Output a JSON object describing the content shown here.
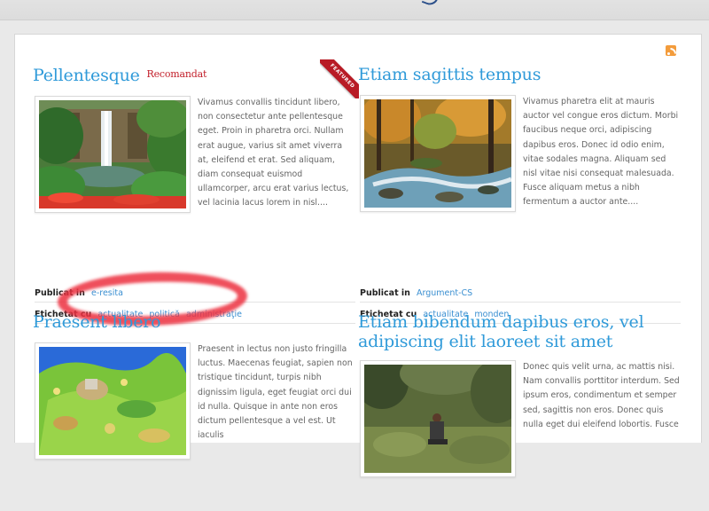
{
  "articles": [
    {
      "title": "Pellentesque",
      "badge": "Recomandat",
      "excerpt": "Vivamus convallis tincidunt libero, non consectetur ante pellentesque eget. Proin in pharetra orci. Nullam erat augue, varius sit amet viverra at, eleifend et erat. Sed aliquam, diam consequat euismod ullamcorper, arcu erat varius lectus, vel lacinia lacus lorem in nisl....",
      "published_label": "Publicat in",
      "category": "e-resita",
      "tags_label": "Etichetat cu",
      "tags": [
        "actualitate",
        "politică",
        "administraţie"
      ]
    },
    {
      "title": "Etiam sagittis tempus",
      "ribbon": "FEATURED",
      "excerpt": "Vivamus pharetra elit at mauris auctor vel congue eros dictum. Morbi faucibus neque orci, adipiscing dapibus eros. Donec id odio enim, vitae sodales magna. Aliquam sed nisl vitae nisi consequat malesuada. Fusce aliquam metus a nibh fermentum a auctor ante....",
      "published_label": "Publicat in",
      "category": "Argument-CS",
      "tags_label": "Etichetat cu",
      "tags": [
        "actualitate",
        "monden"
      ]
    },
    {
      "title": "Praesent libero",
      "excerpt": "Praesent in lectus non justo fringilla luctus. Maecenas feugiat, sapien non tristique tincidunt, turpis nibh dignissim ligula, eget feugiat orci dui id nulla. Quisque in ante non eros dictum pellentesque a vel est. Ut iaculis"
    },
    {
      "title": "Etiam bibendum dapibus eros, vel adipiscing elit laoreet sit amet",
      "excerpt": "Donec quis velit urna, ac mattis nisi. Nam convallis porttitor interdum. Sed ipsum eros, condimentum et semper sed, sagittis non eros. Donec quis nulla eget dui eleifend lobortis. Fusce"
    }
  ],
  "colors": {
    "title": "#2f9ad9",
    "badge": "#c21f2a",
    "link": "#3a8fd1",
    "ribbon": "#b81b25",
    "annotation": "#ec3040"
  },
  "icons": {
    "feed": "rss-icon"
  }
}
